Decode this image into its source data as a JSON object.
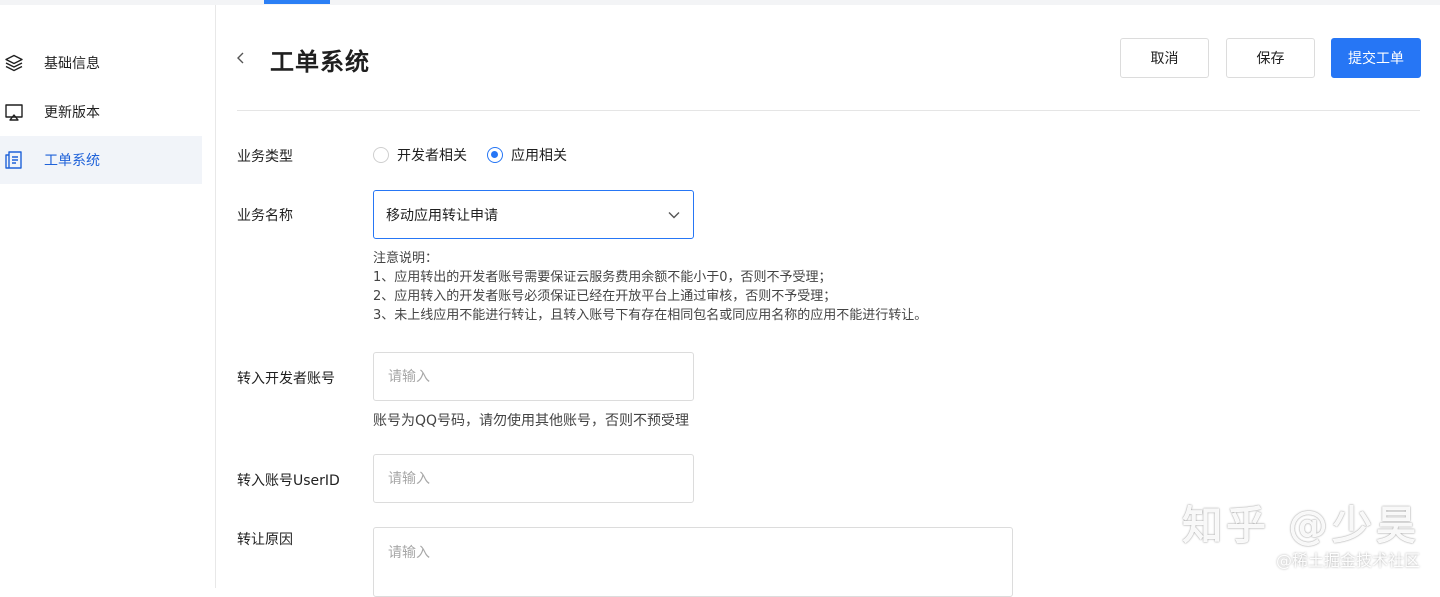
{
  "sidebar": {
    "items": [
      {
        "label": "基础信息",
        "icon": "layers-icon"
      },
      {
        "label": "更新版本",
        "icon": "monitor-icon"
      },
      {
        "label": "工单系统",
        "icon": "document-icon",
        "active": true
      }
    ]
  },
  "header": {
    "title": "工单系统",
    "cancel_label": "取消",
    "save_label": "保存",
    "submit_label": "提交工单"
  },
  "form": {
    "business_type": {
      "label": "业务类型",
      "options": [
        "开发者相关",
        "应用相关"
      ],
      "selected": "应用相关"
    },
    "business_name": {
      "label": "业务名称",
      "value": "移动应用转让申请"
    },
    "notes": [
      "注意说明：",
      "1、应用转出的开发者账号需要保证云服务费用余额不能小于0，否则不予受理；",
      "2、应用转入的开发者账号必须保证已经在开放平台上通过审核，否则不予受理；",
      "3、未上线应用不能进行转让，且转入账号下有存在相同包名或同应用名称的应用不能进行转让。"
    ],
    "developer_account": {
      "label": "转入开发者账号",
      "placeholder": "请输入",
      "hint": "账号为QQ号码，请勿使用其他账号，否则不预受理"
    },
    "user_id": {
      "label": "转入账号UserID",
      "placeholder": "请输入"
    },
    "reason": {
      "label": "转让原因",
      "placeholder": "请输入"
    }
  },
  "watermark": {
    "main": "知乎 @少昊",
    "sub": "@稀土掘金技术社区"
  },
  "colors": {
    "accent": "#2676f5",
    "active_bg": "#f1f4f9"
  }
}
